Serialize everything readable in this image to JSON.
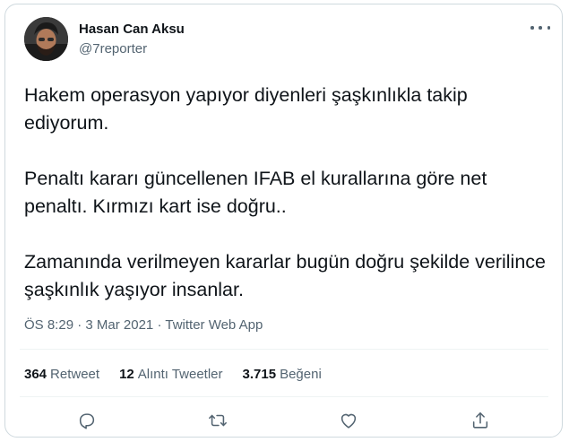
{
  "author": {
    "display_name": "Hasan Can Aksu",
    "handle": "@7reporter",
    "avatar_icon": "profile-photo"
  },
  "tweet": {
    "paragraphs": [
      "Hakem operasyon yapıyor diyenleri şaşkınlıkla takip ediyorum.",
      "Penaltı kararı güncellenen IFAB el kurallarına göre net penaltı. Kırmızı kart ise doğru..",
      "Zamanında verilmeyen kararlar bugün doğru şekilde verilince şaşkınlık yaşıyor insanlar."
    ],
    "time": "ÖS 8:29",
    "date": "3 Mar 2021",
    "separator": "·",
    "source": "Twitter Web App"
  },
  "stats": {
    "retweets_count": "364",
    "retweets_label": "Retweet",
    "quotes_count": "12",
    "quotes_label": "Alıntı Tweetler",
    "likes_count": "3.715",
    "likes_label": "Beğeni"
  },
  "actions": {
    "reply_icon": "reply-icon",
    "retweet_icon": "retweet-icon",
    "like_icon": "like-icon",
    "share_icon": "share-icon"
  },
  "colors": {
    "text": "#0f1419",
    "secondary": "#536471",
    "border": "#cfd9de",
    "divider": "#eff3f4"
  }
}
